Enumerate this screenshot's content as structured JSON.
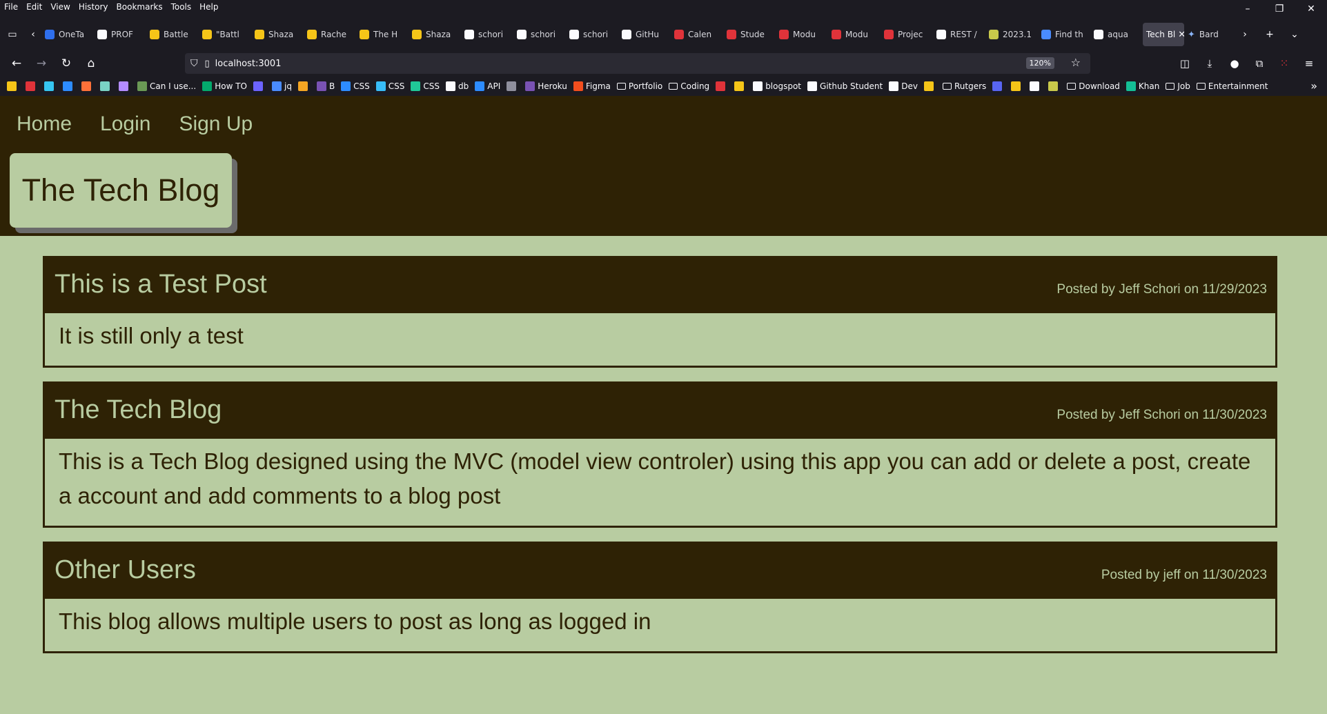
{
  "browser": {
    "menu": [
      "File",
      "Edit",
      "View",
      "History",
      "Bookmarks",
      "Tools",
      "Help"
    ],
    "window_controls": {
      "minimize": "–",
      "restore": "❐",
      "close": "✕"
    },
    "tabs": [
      {
        "label": "OneTa",
        "color": "#2f6fed"
      },
      {
        "label": "PROF",
        "color": "#fbfbfe"
      },
      {
        "label": "Battle",
        "color": "#f5c518"
      },
      {
        "label": "\"Battl",
        "color": "#f5c518"
      },
      {
        "label": "Shaza",
        "color": "#f5c518"
      },
      {
        "label": "Rache",
        "color": "#f5c518"
      },
      {
        "label": "The H",
        "color": "#f5c518"
      },
      {
        "label": "Shaza",
        "color": "#f5c518"
      },
      {
        "label": "schori",
        "color": "#fbfbfe"
      },
      {
        "label": "schori",
        "color": "#fbfbfe"
      },
      {
        "label": "schori",
        "color": "#fbfbfe"
      },
      {
        "label": "GitHu",
        "color": "#fbfbfe"
      },
      {
        "label": "Calen",
        "color": "#e0333a"
      },
      {
        "label": "Stude",
        "color": "#e0333a"
      },
      {
        "label": "Modu",
        "color": "#e0333a"
      },
      {
        "label": "Modu",
        "color": "#e0333a"
      },
      {
        "label": "Projec",
        "color": "#e0333a"
      },
      {
        "label": "REST /",
        "color": "#fbfbfe"
      },
      {
        "label": "2023.1",
        "color": "#c9c94b"
      },
      {
        "label": "Find th",
        "color": "#4a8cff"
      },
      {
        "label": "aqua",
        "color": "#fbfbfe"
      }
    ],
    "active_tab": "Tech Bl",
    "last_tab": "Bard",
    "url": "localhost:3001",
    "zoom": "120%",
    "bookmarks": [
      {
        "label": "",
        "color": "#f5c518"
      },
      {
        "label": "",
        "color": "#e0333a"
      },
      {
        "label": "",
        "color": "#36c5f0"
      },
      {
        "label": "",
        "color": "#2d8cff"
      },
      {
        "label": "",
        "color": "#ff7139"
      },
      {
        "label": "",
        "color": "#7ad3c5"
      },
      {
        "label": "",
        "color": "#b48cff"
      },
      {
        "label": "Can I use...",
        "color": "#6a9955"
      },
      {
        "label": "How TO",
        "color": "#04aa6d"
      },
      {
        "label": "",
        "color": "#6c63ff"
      },
      {
        "label": "jq",
        "color": "#4a8cff"
      },
      {
        "label": "",
        "color": "#f5a623"
      },
      {
        "label": "B",
        "color": "#7952b3"
      },
      {
        "label": "CSS",
        "color": "#2d8cff"
      },
      {
        "label": "CSS",
        "color": "#38bdf8"
      },
      {
        "label": "CSS",
        "color": "#20c997"
      },
      {
        "label": "db",
        "color": "#fbfbfe"
      },
      {
        "label": "API",
        "color": "#2d8cff"
      },
      {
        "label": "",
        "color": "#8f8f9d"
      },
      {
        "label": "Heroku",
        "color": "#7952b3"
      },
      {
        "label": "Figma",
        "color": "#f24e1e"
      },
      {
        "label": "Portfolio",
        "folder": true
      },
      {
        "label": "Coding",
        "folder": true
      },
      {
        "label": "",
        "color": "#e0333a"
      },
      {
        "label": "",
        "color": "#f5c518"
      },
      {
        "label": "blogspot",
        "color": "#fbfbfe"
      },
      {
        "label": "Github Student",
        "color": "#fbfbfe"
      },
      {
        "label": "Dev",
        "color": "#fbfbfe"
      },
      {
        "label": "",
        "color": "#f5c518"
      },
      {
        "label": "Rutgers",
        "folder": true
      },
      {
        "label": "",
        "color": "#5865f2"
      },
      {
        "label": "",
        "color": "#f5c518"
      },
      {
        "label": "",
        "color": "#fbfbfe"
      },
      {
        "label": "",
        "color": "#c9c94b"
      },
      {
        "label": "Download",
        "folder": true
      },
      {
        "label": "Khan",
        "color": "#14bf96"
      },
      {
        "label": "Job",
        "folder": true
      },
      {
        "label": "Entertainment",
        "folder": true
      }
    ]
  },
  "site": {
    "nav": {
      "home": "Home",
      "login": "Login",
      "signup": "Sign Up"
    },
    "title": "The Tech Blog",
    "colors": {
      "dark": "#2e2205",
      "light": "#b8cca1"
    }
  },
  "posts": [
    {
      "title": "This is a Test Post",
      "meta": "Posted by Jeff Schori on 11/29/2023",
      "body": "It is still only a test"
    },
    {
      "title": "The Tech Blog",
      "meta": "Posted by Jeff Schori on 11/30/2023",
      "body": "This is a Tech Blog designed using the MVC (model view controler) using this app you can add or delete a post, create a account and add comments to a blog post"
    },
    {
      "title": "Other Users",
      "meta": "Posted by jeff on 11/30/2023",
      "body": "This blog allows multiple users to post as long as logged in"
    }
  ]
}
